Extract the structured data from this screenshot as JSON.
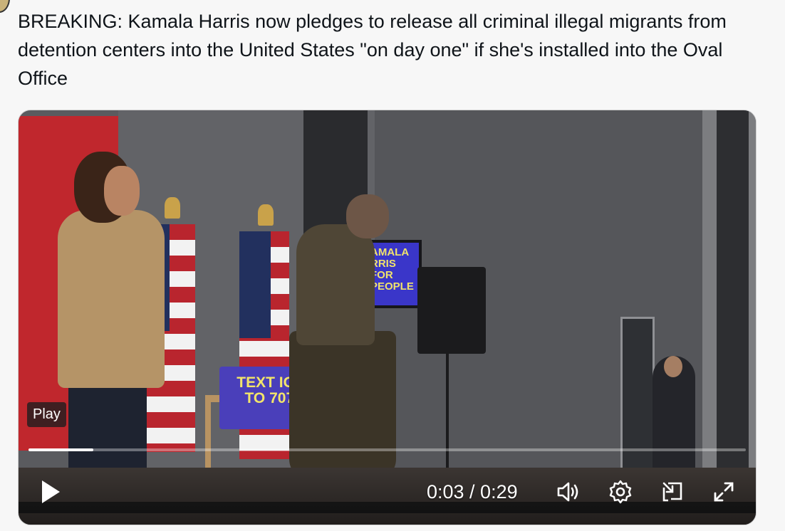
{
  "tweet": {
    "text": "BREAKING: Kamala Harris now pledges to release all criminal illegal migrants from detention centers into the United States \"on day one\" if she's installed into the Oval Office"
  },
  "video": {
    "play_badge": "Play",
    "current_time": "0:03",
    "duration": "0:29",
    "time_display": "0:03 / 0:29",
    "progress": 0.09,
    "monitor_text": "AMALA RRIS FOR PEOPLE",
    "sign_text_line1": "TEXT IOWA",
    "sign_text_line2": "TO 70785",
    "controls": {
      "play_icon": "play-icon",
      "volume_icon": "volume-icon",
      "settings_icon": "gear-icon",
      "pip_icon": "picture-in-picture-icon",
      "fullscreen_icon": "fullscreen-icon"
    }
  },
  "colors": {
    "text": "#0f1419",
    "background": "#f7f7f7",
    "sign": "#4a3fba",
    "sign_text": "#f3e56a"
  }
}
